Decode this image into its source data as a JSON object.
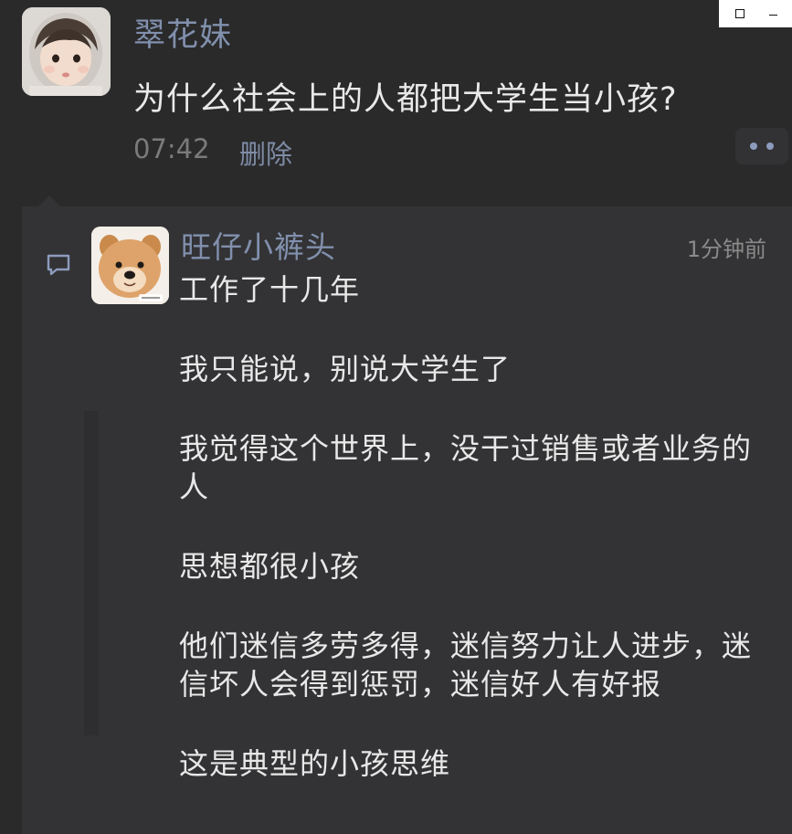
{
  "window_controls": {
    "maximize_icon": "square-icon",
    "minimize_icon": "minus-icon"
  },
  "post": {
    "author": "翠花妹",
    "text": "为什么社会上的人都把大学生当小孩?",
    "time": "07:42",
    "delete_label": "删除",
    "more_icon": "more-dots-icon"
  },
  "comment": {
    "author": "旺仔小裤头",
    "time": "1分钟前",
    "icon": "comment-icon",
    "paragraphs": [
      "工作了十几年",
      "我只能说，别说大学生了",
      "我觉得这个世界上，没干过销售或者业务的人",
      "思想都很小孩",
      "他们迷信多劳多得，迷信努力让人进步，迷信坏人会得到惩罚，迷信好人有好报",
      "这是典型的小孩思维"
    ]
  },
  "colors": {
    "background": "#2a2a2b",
    "panel": "#333335",
    "name_blue": "#8190ad",
    "text": "#e8e8e8",
    "muted": "#7b7b7b"
  }
}
